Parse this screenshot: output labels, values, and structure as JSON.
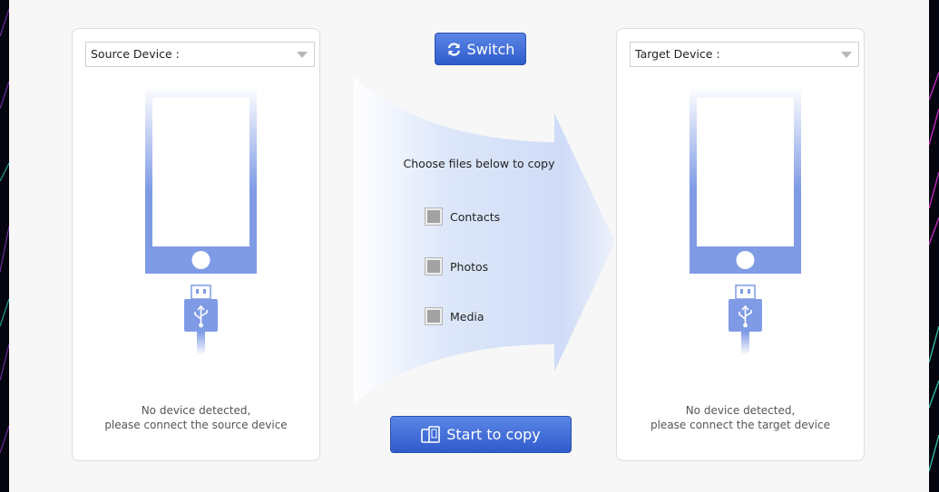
{
  "source_panel": {
    "select_label": "Source Device :",
    "message_line1": "No device detected,",
    "message_line2": "please connect the source device"
  },
  "target_panel": {
    "select_label": "Target Device :",
    "message_line1": "No device detected,",
    "message_line2": "please connect the target device"
  },
  "center": {
    "switch_label": "Switch",
    "choose_text": "Choose files below to copy",
    "options": [
      {
        "label": "Contacts",
        "checked": false
      },
      {
        "label": "Photos",
        "checked": false
      },
      {
        "label": "Media",
        "checked": false
      }
    ],
    "start_label": "Start to copy"
  },
  "icons": {
    "switch": "refresh-icon",
    "start": "devices-icon",
    "usb": "usb-icon",
    "dropdown": "chevron-down-icon"
  },
  "colors": {
    "button": "#3e6ad6",
    "phone": "#7f9be6",
    "arrow_fill": "#dce6fa"
  }
}
